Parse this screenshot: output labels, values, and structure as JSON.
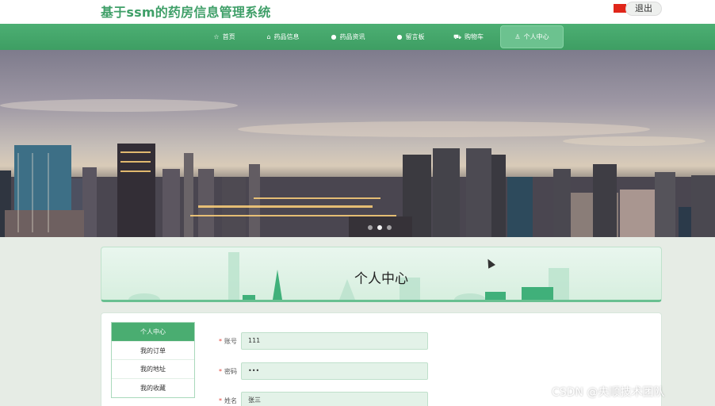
{
  "header": {
    "site_title": "基于ssm的药房信息管理系统",
    "logout_label": "退出"
  },
  "nav": {
    "items": [
      {
        "label": "首页",
        "icon": "star-icon",
        "glyph": "☆"
      },
      {
        "label": "药品信息",
        "icon": "lock-icon",
        "glyph": "⌂"
      },
      {
        "label": "药品资讯",
        "icon": "circle-icon",
        "glyph": "●"
      },
      {
        "label": "留言板",
        "icon": "circle-icon",
        "glyph": "●"
      },
      {
        "label": "购物车",
        "icon": "cart-icon",
        "glyph": "⛟"
      },
      {
        "label": "个人中心",
        "icon": "user-icon",
        "glyph": "♙"
      }
    ],
    "active_index": 5
  },
  "banner": {
    "active_slide": 1,
    "slide_count": 3
  },
  "page": {
    "title": "个人中心"
  },
  "side_menu": {
    "items": [
      {
        "label": "个人中心",
        "active": true
      },
      {
        "label": "我的订单",
        "active": false
      },
      {
        "label": "我的地址",
        "active": false
      },
      {
        "label": "我的收藏",
        "active": false
      }
    ]
  },
  "form": {
    "fields": [
      {
        "label": "账号",
        "value": "111"
      },
      {
        "label": "密码",
        "value": "•••"
      },
      {
        "label": "姓名",
        "value": "张三"
      }
    ]
  },
  "watermark": "CSDN @央顺技术团队",
  "colors": {
    "brand_green": "#4caf73",
    "active_green": "#4aad71",
    "required_red": "#e2443a"
  }
}
